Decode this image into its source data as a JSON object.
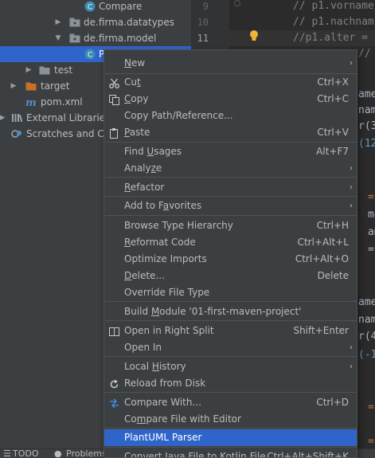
{
  "tree": {
    "items": [
      {
        "label": "Compare",
        "icon": "class-icon"
      },
      {
        "label": "de.firma.datatypes",
        "icon": "package-icon"
      },
      {
        "label": "de.firma.model",
        "icon": "package-icon"
      },
      {
        "label": "P",
        "icon": "class-icon"
      },
      {
        "label": "test",
        "icon": "folder-icon"
      },
      {
        "label": "target",
        "icon": "folder-icon"
      },
      {
        "label": "pom.xml",
        "icon": "maven-icon"
      },
      {
        "label": "External Libraries",
        "icon": "libraries-icon"
      },
      {
        "label": "Scratches and Con",
        "icon": "scratches-icon"
      }
    ]
  },
  "editor": {
    "line_numbers": [
      "9",
      "10",
      "11"
    ],
    "lines": [
      "// p1.vorname",
      "// p1.nachnam",
      "//p1.alter =",
      "// ",
      "ame",
      "nam",
      "r(3",
      "(12",
      "= n",
      "me",
      "ame",
      "= ",
      "ame",
      "nam",
      "r(4",
      "(-1",
      "= n",
      "= n"
    ]
  },
  "menu": {
    "items": [
      {
        "pre": "",
        "u": "N",
        "post": "ew",
        "shortcut": "",
        "submenu": true,
        "icon": ""
      },
      {
        "pre": "Cu",
        "u": "t",
        "post": "",
        "shortcut": "Ctrl+X",
        "submenu": false,
        "icon": "cut-icon"
      },
      {
        "pre": "",
        "u": "C",
        "post": "opy",
        "shortcut": "Ctrl+C",
        "submenu": false,
        "icon": "copy-icon"
      },
      {
        "pre": "Copy Path/Reference...",
        "u": "",
        "post": "",
        "shortcut": "",
        "submenu": false,
        "icon": ""
      },
      {
        "pre": "",
        "u": "P",
        "post": "aste",
        "shortcut": "Ctrl+V",
        "submenu": false,
        "icon": "paste-icon"
      },
      {
        "pre": "Find ",
        "u": "U",
        "post": "sages",
        "shortcut": "Alt+F7",
        "submenu": false,
        "icon": ""
      },
      {
        "pre": "Analy",
        "u": "z",
        "post": "e",
        "shortcut": "",
        "submenu": true,
        "icon": ""
      },
      {
        "pre": "",
        "u": "R",
        "post": "efactor",
        "shortcut": "",
        "submenu": true,
        "icon": ""
      },
      {
        "pre": "Add to F",
        "u": "a",
        "post": "vorites",
        "shortcut": "",
        "submenu": true,
        "icon": ""
      },
      {
        "pre": "Browse Type Hierarchy",
        "u": "",
        "post": "",
        "shortcut": "Ctrl+H",
        "submenu": false,
        "icon": ""
      },
      {
        "pre": "",
        "u": "R",
        "post": "eformat Code",
        "shortcut": "Ctrl+Alt+L",
        "submenu": false,
        "icon": ""
      },
      {
        "pre": "Optimize Imports",
        "u": "",
        "post": "",
        "shortcut": "Ctrl+Alt+O",
        "submenu": false,
        "icon": ""
      },
      {
        "pre": "",
        "u": "D",
        "post": "elete...",
        "shortcut": "Delete",
        "submenu": false,
        "icon": ""
      },
      {
        "pre": "Override File Type",
        "u": "",
        "post": "",
        "shortcut": "",
        "submenu": false,
        "icon": ""
      },
      {
        "pre": "Build ",
        "u": "M",
        "post": "odule '01-first-maven-project'",
        "shortcut": "",
        "submenu": false,
        "icon": ""
      },
      {
        "pre": "Open in Right Split",
        "u": "",
        "post": "",
        "shortcut": "Shift+Enter",
        "submenu": false,
        "icon": "split-icon"
      },
      {
        "pre": "Open In",
        "u": "",
        "post": "",
        "shortcut": "",
        "submenu": true,
        "icon": ""
      },
      {
        "pre": "Local ",
        "u": "H",
        "post": "istory",
        "shortcut": "",
        "submenu": true,
        "icon": ""
      },
      {
        "pre": "Reload from Disk",
        "u": "",
        "post": "",
        "shortcut": "",
        "submenu": false,
        "icon": "reload-icon"
      },
      {
        "pre": "Compare With...",
        "u": "",
        "post": "",
        "shortcut": "Ctrl+D",
        "submenu": false,
        "icon": "compare-icon"
      },
      {
        "pre": "Co",
        "u": "m",
        "post": "pare File with Editor",
        "shortcut": "",
        "submenu": false,
        "icon": ""
      },
      {
        "pre": "PlantUML Parser",
        "u": "",
        "post": "",
        "shortcut": "",
        "submenu": false,
        "icon": ""
      },
      {
        "pre": "Convert Java File to Kotlin File",
        "u": "",
        "post": "",
        "shortcut": "Ctrl+Alt+Shift+K",
        "submenu": false,
        "icon": ""
      }
    ]
  },
  "bottombar": {
    "todo": "TODO",
    "problems": "Problems"
  },
  "colors": {
    "selection": "#2f65ca",
    "panel": "#3c3f41",
    "editor_bg": "#2b2b2b"
  }
}
